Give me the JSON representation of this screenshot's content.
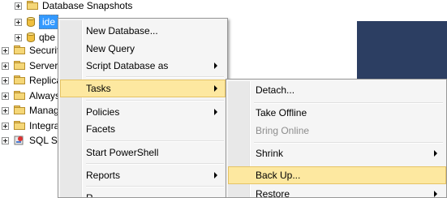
{
  "tree": {
    "items": [
      {
        "label": "Database Snapshots",
        "icon": "folder-icon"
      },
      {
        "label": "ide",
        "icon": "database-icon",
        "selected": true
      },
      {
        "label": "qbe",
        "icon": "database-icon"
      },
      {
        "label": "Securit",
        "icon": "folder-icon"
      },
      {
        "label": "Server",
        "icon": "folder-icon"
      },
      {
        "label": "Replica",
        "icon": "folder-icon"
      },
      {
        "label": "Always",
        "icon": "folder-icon"
      },
      {
        "label": "Manag",
        "icon": "folder-icon"
      },
      {
        "label": "Integra",
        "icon": "folder-icon"
      },
      {
        "label": "SQL Se",
        "icon": "sql-agent-icon"
      }
    ]
  },
  "context_menu": {
    "items": [
      {
        "label": "New Database..."
      },
      {
        "label": "New Query"
      },
      {
        "label": "Script Database as",
        "submenu": true
      },
      {
        "label": "Tasks",
        "submenu": true,
        "highlighted": true
      },
      {
        "label": "Policies",
        "submenu": true
      },
      {
        "label": "Facets"
      },
      {
        "label": "Start PowerShell"
      },
      {
        "label": "Reports",
        "submenu": true
      },
      {
        "label": "R"
      }
    ]
  },
  "tasks_submenu": {
    "items": [
      {
        "label": "Detach..."
      },
      {
        "label": "Take Offline"
      },
      {
        "label": "Bring Online",
        "disabled": true
      },
      {
        "label": "Shrink",
        "submenu": true
      },
      {
        "label": "Back Up...",
        "highlighted": true
      },
      {
        "label": "Restore",
        "submenu": true
      }
    ]
  },
  "colors": {
    "menu_bg": "#f5f5f5",
    "highlight": "#fde8a0",
    "selection": "#3399ff",
    "navy_panel": "#2c3e62"
  }
}
